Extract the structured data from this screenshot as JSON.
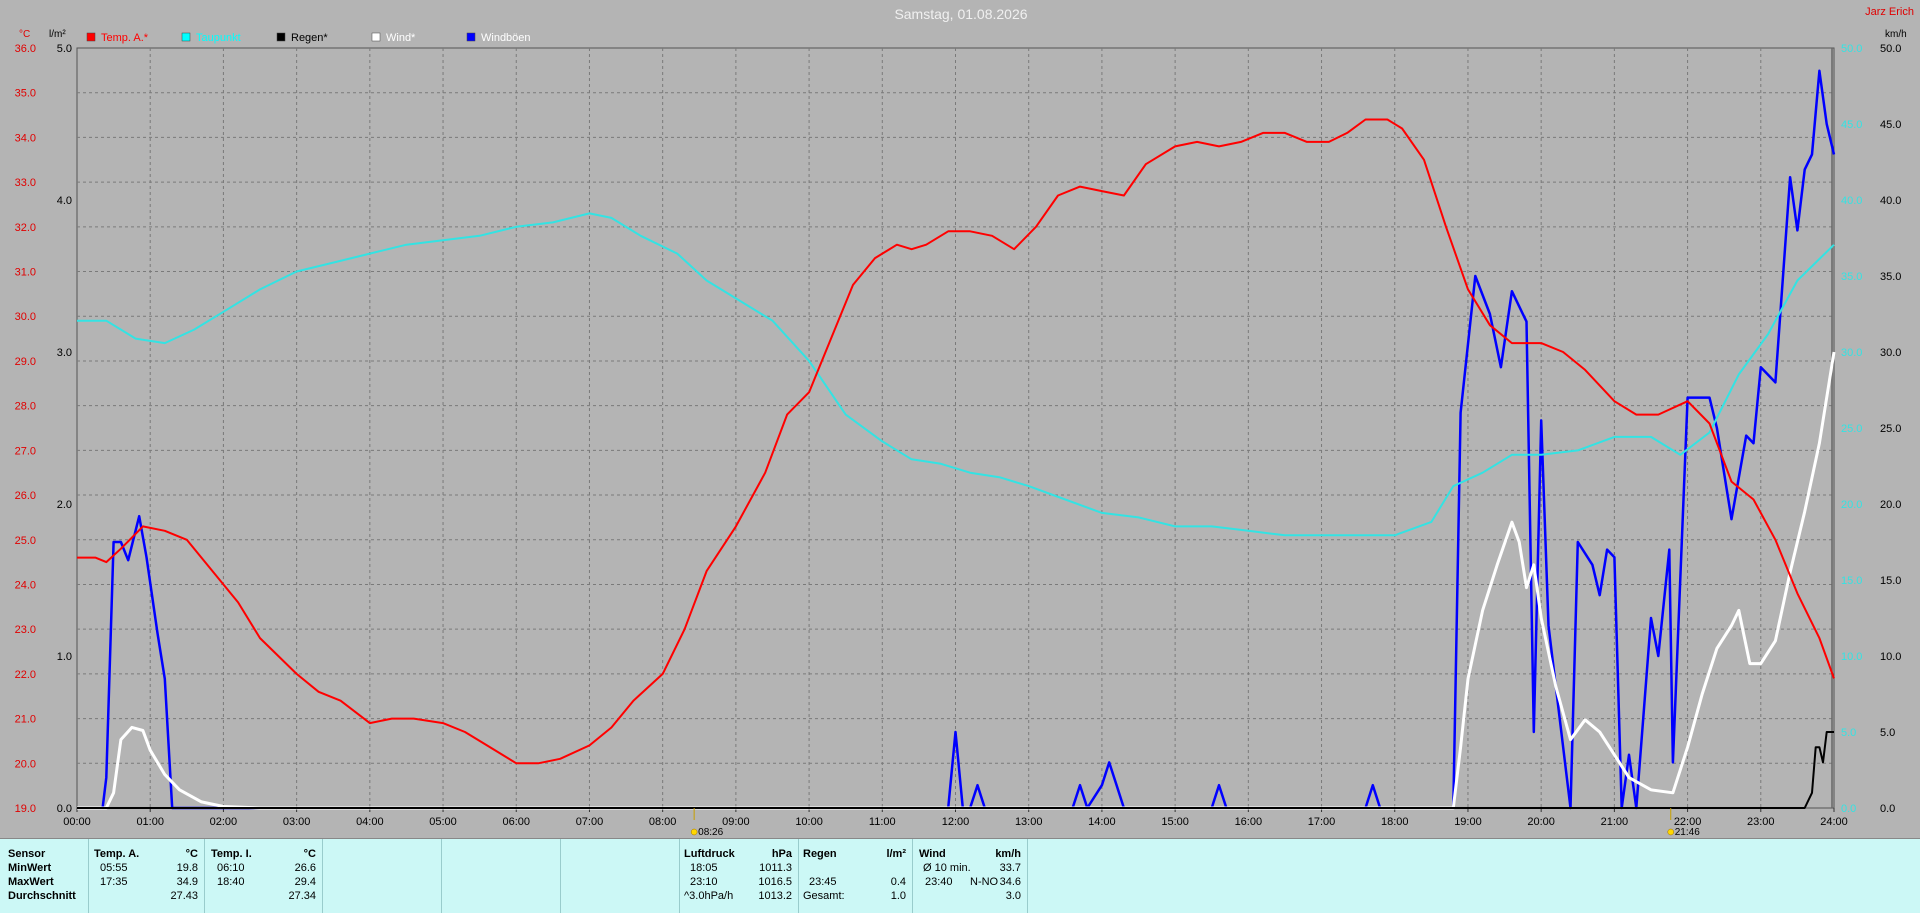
{
  "title": "Samstag, 01.08.2026",
  "brand": "Jarz Erich",
  "unit_left_temp": "°C",
  "unit_left_rain": "l/m²",
  "unit_right_wind": "km/h",
  "legend": [
    {
      "label": "Temp. A.*",
      "color": "#ff0000",
      "text_color": "#ff0000"
    },
    {
      "label": "Taupunkt",
      "color": "#00ffff",
      "text_color": "#00ffff"
    },
    {
      "label": "Regen*",
      "color": "#000000",
      "text_color": "#000000"
    },
    {
      "label": "Wind*",
      "color": "#ffffff",
      "text_color": "#ffffff"
    },
    {
      "label": "Windböen",
      "color": "#0000ff",
      "text_color": "#ffffff"
    }
  ],
  "colors": {
    "temp": "#ff0000",
    "dew": "#33e3e3",
    "rain": "#000000",
    "wind": "#ffffff",
    "gust": "#0000ff",
    "bg": "#b4b4b4",
    "grid": "#7a7a7a"
  },
  "chart_data": {
    "type": "line",
    "x_ticks": [
      "00:00",
      "01:00",
      "02:00",
      "03:00",
      "04:00",
      "05:00",
      "06:00",
      "07:00",
      "08:00",
      "09:00",
      "10:00",
      "11:00",
      "12:00",
      "13:00",
      "14:00",
      "15:00",
      "16:00",
      "17:00",
      "18:00",
      "19:00",
      "20:00",
      "21:00",
      "22:00",
      "23:00",
      "24:00"
    ],
    "y_left_temp_ticks": [
      "19.0",
      "20.0",
      "21.0",
      "22.0",
      "23.0",
      "24.0",
      "25.0",
      "26.0",
      "27.0",
      "28.0",
      "29.0",
      "30.0",
      "31.0",
      "32.0",
      "33.0",
      "34.0",
      "35.0",
      "36.0"
    ],
    "y_left_rain_ticks": [
      "0.0",
      "1.0",
      "2.0",
      "3.0",
      "4.0",
      "5.0"
    ],
    "y_right_wind_ticks": [
      "0.0",
      "5.0",
      "10.0",
      "15.0",
      "20.0",
      "25.0",
      "30.0",
      "35.0",
      "40.0",
      "45.0",
      "50.0"
    ],
    "temp_range": [
      19,
      36
    ],
    "rain_range": [
      0,
      5
    ],
    "wind_range": [
      0,
      50
    ],
    "markers": [
      {
        "time": 8.43,
        "label": "08:26"
      },
      {
        "time": 21.77,
        "label": "21:46"
      }
    ],
    "series": [
      {
        "name": "Temp. A.*",
        "axis": "temp",
        "points": [
          [
            0,
            24.6
          ],
          [
            0.25,
            24.6
          ],
          [
            0.4,
            24.5
          ],
          [
            0.6,
            24.8
          ],
          [
            0.9,
            25.3
          ],
          [
            1.2,
            25.2
          ],
          [
            1.5,
            25.0
          ],
          [
            1.8,
            24.4
          ],
          [
            2.2,
            23.6
          ],
          [
            2.5,
            22.8
          ],
          [
            3.0,
            22.0
          ],
          [
            3.3,
            21.6
          ],
          [
            3.6,
            21.4
          ],
          [
            4.0,
            20.9
          ],
          [
            4.3,
            21.0
          ],
          [
            4.6,
            21.0
          ],
          [
            5.0,
            20.9
          ],
          [
            5.3,
            20.7
          ],
          [
            5.6,
            20.4
          ],
          [
            6.0,
            20.0
          ],
          [
            6.3,
            20.0
          ],
          [
            6.6,
            20.1
          ],
          [
            7.0,
            20.4
          ],
          [
            7.3,
            20.8
          ],
          [
            7.6,
            21.4
          ],
          [
            8.0,
            22.0
          ],
          [
            8.3,
            23.0
          ],
          [
            8.6,
            24.3
          ],
          [
            9.0,
            25.3
          ],
          [
            9.4,
            26.5
          ],
          [
            9.7,
            27.8
          ],
          [
            10.0,
            28.3
          ],
          [
            10.3,
            29.5
          ],
          [
            10.6,
            30.7
          ],
          [
            10.9,
            31.3
          ],
          [
            11.2,
            31.6
          ],
          [
            11.4,
            31.5
          ],
          [
            11.6,
            31.6
          ],
          [
            11.9,
            31.9
          ],
          [
            12.2,
            31.9
          ],
          [
            12.5,
            31.8
          ],
          [
            12.8,
            31.5
          ],
          [
            13.1,
            32.0
          ],
          [
            13.4,
            32.7
          ],
          [
            13.7,
            32.9
          ],
          [
            14.0,
            32.8
          ],
          [
            14.3,
            32.7
          ],
          [
            14.6,
            33.4
          ],
          [
            15.0,
            33.8
          ],
          [
            15.3,
            33.9
          ],
          [
            15.6,
            33.8
          ],
          [
            15.9,
            33.9
          ],
          [
            16.2,
            34.1
          ],
          [
            16.5,
            34.1
          ],
          [
            16.8,
            33.9
          ],
          [
            17.1,
            33.9
          ],
          [
            17.35,
            34.1
          ],
          [
            17.6,
            34.4
          ],
          [
            17.9,
            34.4
          ],
          [
            18.1,
            34.2
          ],
          [
            18.4,
            33.5
          ],
          [
            18.7,
            32.0
          ],
          [
            19.0,
            30.6
          ],
          [
            19.3,
            29.8
          ],
          [
            19.6,
            29.4
          ],
          [
            20.0,
            29.4
          ],
          [
            20.3,
            29.2
          ],
          [
            20.6,
            28.8
          ],
          [
            21.0,
            28.1
          ],
          [
            21.3,
            27.8
          ],
          [
            21.6,
            27.8
          ],
          [
            22.0,
            28.1
          ],
          [
            22.3,
            27.6
          ],
          [
            22.6,
            26.3
          ],
          [
            22.9,
            25.9
          ],
          [
            23.2,
            25.0
          ],
          [
            23.5,
            23.8
          ],
          [
            23.8,
            22.8
          ],
          [
            24,
            21.9
          ]
        ]
      },
      {
        "name": "Taupunkt",
        "axis": "temp",
        "points": [
          [
            0,
            29.9
          ],
          [
            0.4,
            29.9
          ],
          [
            0.8,
            29.5
          ],
          [
            1.2,
            29.4
          ],
          [
            1.6,
            29.7
          ],
          [
            2.0,
            30.1
          ],
          [
            2.5,
            30.6
          ],
          [
            3.0,
            31.0
          ],
          [
            3.5,
            31.2
          ],
          [
            4.0,
            31.4
          ],
          [
            4.5,
            31.6
          ],
          [
            5.0,
            31.7
          ],
          [
            5.5,
            31.8
          ],
          [
            6.0,
            32.0
          ],
          [
            6.5,
            32.1
          ],
          [
            7.0,
            32.3
          ],
          [
            7.3,
            32.2
          ],
          [
            7.7,
            31.8
          ],
          [
            8.2,
            31.4
          ],
          [
            8.6,
            30.8
          ],
          [
            9.0,
            30.4
          ],
          [
            9.5,
            29.9
          ],
          [
            10.0,
            29.0
          ],
          [
            10.5,
            27.8
          ],
          [
            11.0,
            27.2
          ],
          [
            11.4,
            26.8
          ],
          [
            11.8,
            26.7
          ],
          [
            12.2,
            26.5
          ],
          [
            12.6,
            26.4
          ],
          [
            13.0,
            26.2
          ],
          [
            13.5,
            25.9
          ],
          [
            14.0,
            25.6
          ],
          [
            14.5,
            25.5
          ],
          [
            15.0,
            25.3
          ],
          [
            15.5,
            25.3
          ],
          [
            16.0,
            25.2
          ],
          [
            16.5,
            25.1
          ],
          [
            17.0,
            25.1
          ],
          [
            17.5,
            25.1
          ],
          [
            18.0,
            25.1
          ],
          [
            18.5,
            25.4
          ],
          [
            18.8,
            26.2
          ],
          [
            19.2,
            26.5
          ],
          [
            19.6,
            26.9
          ],
          [
            20.0,
            26.9
          ],
          [
            20.5,
            27.0
          ],
          [
            21.0,
            27.3
          ],
          [
            21.5,
            27.3
          ],
          [
            21.9,
            26.9
          ],
          [
            22.3,
            27.4
          ],
          [
            22.7,
            28.7
          ],
          [
            23.1,
            29.6
          ],
          [
            23.5,
            30.8
          ],
          [
            24,
            31.6
          ]
        ]
      },
      {
        "name": "Wind*",
        "axis": "wind",
        "points": [
          [
            0,
            0
          ],
          [
            0.4,
            0
          ],
          [
            0.5,
            1.0
          ],
          [
            0.6,
            4.5
          ],
          [
            0.75,
            5.3
          ],
          [
            0.9,
            5.1
          ],
          [
            1.0,
            3.8
          ],
          [
            1.2,
            2.2
          ],
          [
            1.4,
            1.2
          ],
          [
            1.7,
            0.4
          ],
          [
            2.0,
            0.1
          ],
          [
            2.5,
            0
          ],
          [
            18.8,
            0
          ],
          [
            18.9,
            4.0
          ],
          [
            19.0,
            8.5
          ],
          [
            19.2,
            13.0
          ],
          [
            19.4,
            16.0
          ],
          [
            19.6,
            18.8
          ],
          [
            19.7,
            17.5
          ],
          [
            19.8,
            14.5
          ],
          [
            19.9,
            16.0
          ],
          [
            20.0,
            12.5
          ],
          [
            20.2,
            8.0
          ],
          [
            20.4,
            4.5
          ],
          [
            20.6,
            5.8
          ],
          [
            20.8,
            5.0
          ],
          [
            21.0,
            3.5
          ],
          [
            21.2,
            2.0
          ],
          [
            21.5,
            1.2
          ],
          [
            21.8,
            1.0
          ],
          [
            22.0,
            4.0
          ],
          [
            22.2,
            7.5
          ],
          [
            22.4,
            10.5
          ],
          [
            22.6,
            12.0
          ],
          [
            22.7,
            13.0
          ],
          [
            22.85,
            9.5
          ],
          [
            23.0,
            9.5
          ],
          [
            23.2,
            11.0
          ],
          [
            23.4,
            15.5
          ],
          [
            23.6,
            19.5
          ],
          [
            23.8,
            24.0
          ],
          [
            24,
            30.0
          ]
        ]
      },
      {
        "name": "Windböen",
        "axis": "wind",
        "points": [
          [
            0,
            0
          ],
          [
            0.3,
            0
          ],
          [
            0.35,
            0
          ],
          [
            0.4,
            2.0
          ],
          [
            0.5,
            17.5
          ],
          [
            0.6,
            17.5
          ],
          [
            0.7,
            16.3
          ],
          [
            0.85,
            19.2
          ],
          [
            0.95,
            16.5
          ],
          [
            1.1,
            11.5
          ],
          [
            1.2,
            8.5
          ],
          [
            1.3,
            0
          ],
          [
            1.5,
            0
          ],
          [
            11.9,
            0
          ],
          [
            12.0,
            5.0
          ],
          [
            12.1,
            0
          ],
          [
            12.2,
            0
          ],
          [
            12.3,
            1.5
          ],
          [
            12.4,
            0
          ],
          [
            13.6,
            0
          ],
          [
            13.7,
            1.5
          ],
          [
            13.8,
            0
          ],
          [
            14.0,
            1.5
          ],
          [
            14.1,
            3.0
          ],
          [
            14.2,
            1.5
          ],
          [
            14.3,
            0
          ],
          [
            15.5,
            0
          ],
          [
            15.6,
            1.5
          ],
          [
            15.7,
            0
          ],
          [
            17.6,
            0
          ],
          [
            17.7,
            1.5
          ],
          [
            17.8,
            0
          ],
          [
            18.8,
            0
          ],
          [
            18.9,
            26.0
          ],
          [
            19.1,
            35.0
          ],
          [
            19.3,
            32.5
          ],
          [
            19.45,
            29.0
          ],
          [
            19.6,
            34.0
          ],
          [
            19.8,
            32.0
          ],
          [
            19.9,
            5.0
          ],
          [
            20.0,
            25.5
          ],
          [
            20.1,
            12.0
          ],
          [
            20.2,
            8.0
          ],
          [
            20.4,
            0
          ],
          [
            20.5,
            17.5
          ],
          [
            20.7,
            16.0
          ],
          [
            20.8,
            14.0
          ],
          [
            20.9,
            17.0
          ],
          [
            21.0,
            16.5
          ],
          [
            21.1,
            0
          ],
          [
            21.2,
            3.5
          ],
          [
            21.3,
            0
          ],
          [
            21.5,
            12.5
          ],
          [
            21.6,
            10.0
          ],
          [
            21.75,
            17.0
          ],
          [
            21.8,
            3.0
          ],
          [
            22.0,
            27.0
          ],
          [
            22.3,
            27.0
          ],
          [
            22.4,
            25.0
          ],
          [
            22.6,
            19.0
          ],
          [
            22.8,
            24.5
          ],
          [
            22.9,
            24.0
          ],
          [
            23.0,
            29.0
          ],
          [
            23.2,
            28.0
          ],
          [
            23.4,
            41.5
          ],
          [
            23.5,
            38.0
          ],
          [
            23.6,
            42.0
          ],
          [
            23.7,
            43.0
          ],
          [
            23.8,
            48.5
          ],
          [
            23.9,
            45.0
          ],
          [
            24,
            43.0
          ]
        ]
      },
      {
        "name": "Regen*",
        "axis": "rain",
        "points": [
          [
            0,
            0
          ],
          [
            23.6,
            0
          ],
          [
            23.7,
            0.1
          ],
          [
            23.75,
            0.4
          ],
          [
            23.8,
            0.4
          ],
          [
            23.85,
            0.3
          ],
          [
            23.9,
            0.5
          ],
          [
            24,
            0.5
          ]
        ]
      }
    ]
  },
  "stats": {
    "sensor_label": "Sensor",
    "min_label": "MinWert",
    "max_label": "MaxWert",
    "avg_label": "Durchschnitt",
    "temp_a": {
      "header": "Temp. A.",
      "unit": "°C",
      "min_time": "05:55",
      "min_val": "19.8",
      "max_time": "17:35",
      "max_val": "34.9",
      "avg": "27.43"
    },
    "temp_i": {
      "header": "Temp. I.",
      "unit": "°C",
      "min_time": "06:10",
      "min_val": "26.6",
      "max_time": "18:40",
      "max_val": "29.4",
      "avg": "27.34"
    },
    "pressure": {
      "header": "Luftdruck",
      "unit": "hPa",
      "min_time": "18:05",
      "min_val": "1011.3",
      "max_time": "23:10",
      "max_val": "1016.5",
      "trend": "^3.0hPa/h",
      "avg": "1013.2"
    },
    "rain": {
      "header": "Regen",
      "unit": "l/m²",
      "max_time": "23:45",
      "max_val": "0.4",
      "total_label": "Gesamt:",
      "total": "1.0"
    },
    "wind": {
      "header": "Wind",
      "unit": "km/h",
      "avg10_label": "Ø 10 min.",
      "avg10": "33.7",
      "max_time": "23:40",
      "max_dir": "N-NO",
      "max_val": "34.6",
      "avg": "3.0"
    }
  }
}
